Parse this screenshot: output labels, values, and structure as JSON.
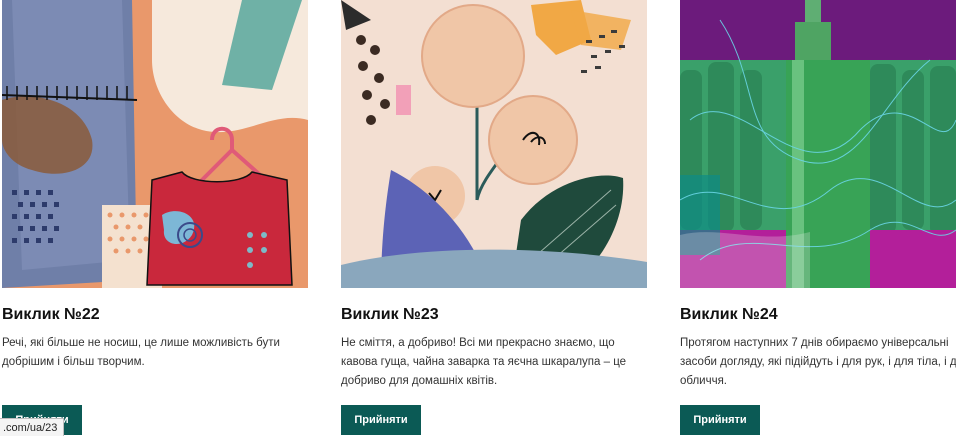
{
  "cards": [
    {
      "title": "Виклик №22",
      "description": "Речі, які більше не носиш, це лише можливість бути добрішим і більш творчим.",
      "button_label": "Прийняти"
    },
    {
      "title": "Виклик №23",
      "description": "Не сміття, а добриво! Всі ми прекрасно знаємо, що кавова гуща, чайна заварка та яєчна шкаралупа – це добриво для домашніх квітів.",
      "button_label": "Прийняти"
    },
    {
      "title": "Виклик №24",
      "description_lines": [
        "Протягом наступних 7 днів обираємо універсальні",
        "засоби догляду, які підійдуть і для рук, і для тіла, і д",
        "обличчя."
      ],
      "button_label": "Прийняти"
    }
  ],
  "status_bar": {
    "url": ".com/ua/23"
  },
  "colors": {
    "button_bg": "#0b5a55",
    "button_text": "#ffffff",
    "card1_bg": "#e9986b",
    "card2_bg": "#f3dfd2",
    "card3_bg": "#7c1f8d"
  }
}
